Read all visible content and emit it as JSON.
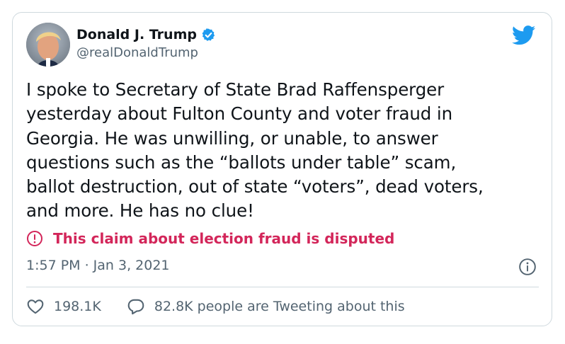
{
  "user": {
    "display_name": "Donald J. Trump",
    "handle": "@realDonaldTrump",
    "verified": true
  },
  "icons": {
    "verified": "verified-badge-icon",
    "brand": "twitter-bird-icon",
    "warning": "exclamation-circle-icon",
    "info": "info-icon",
    "like": "heart-icon",
    "reply": "speech-bubble-icon"
  },
  "tweet": {
    "text": "I spoke to Secretary of State Brad Raffensperger\nyesterday about Fulton County and voter fraud in\nGeorgia. He was unwilling, or unable, to answer\nquestions such as the “ballots under table” scam,\nballot destruction, out of state “voters”, dead voters,\nand more. He has no clue!",
    "label": "This claim about election fraud is disputed",
    "timestamp": "1:57 PM · Jan 3, 2021"
  },
  "engagement": {
    "likes": "198.1K",
    "conversation": "82.8K people are Tweeting about this"
  },
  "colors": {
    "brand_blue": "#1d9bf0",
    "disputed_red": "#d3265a",
    "secondary_text": "#536471",
    "border": "#cfd9de"
  }
}
